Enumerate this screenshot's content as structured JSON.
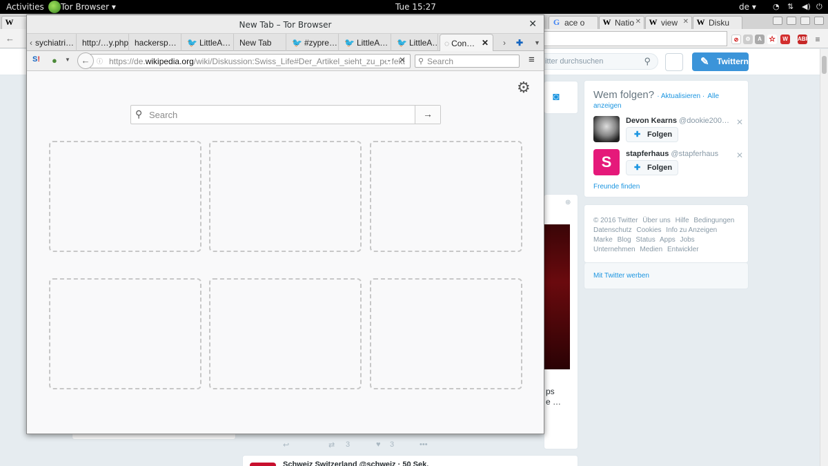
{
  "topbar": {
    "activities": "Activities",
    "app_name": "Tor Browser ▾",
    "clock": "Tue 15:27",
    "keyboard": "de ▾"
  },
  "background": {
    "tabs": [
      {
        "fav": "W",
        "label": "W",
        "color": "#000000"
      },
      {
        "fav": "G",
        "label": "ace o",
        "color": "#4285f4"
      },
      {
        "fav": "W",
        "label": "Natio",
        "color": "#000000"
      },
      {
        "fav": "W",
        "label": "view",
        "color": "#000000"
      },
      {
        "fav": "W",
        "label": "Disku",
        "color": "#000000"
      }
    ],
    "twitter": {
      "search_placeholder": "itter durchsuchen",
      "tweet_button": "Twittern",
      "who_to_follow": {
        "title": "Wem folgen?",
        "refresh": "· Aktualisieren ·",
        "all": "Alle",
        "all2": "anzeigen",
        "people": [
          {
            "name": "Devon Kearns",
            "handle": "@dookie200…",
            "button": "Folgen"
          },
          {
            "name": "stapferhaus",
            "handle": "@stapferhaus",
            "button": "Folgen"
          }
        ],
        "find_friends": "Freunde finden"
      },
      "footer": [
        "© 2016 Twitter",
        "Über uns",
        "Hilfe",
        "Bedingungen",
        "Datenschutz",
        "Cookies",
        "Info zu Anzeigen",
        "Marke",
        "Blog",
        "Status",
        "Apps",
        "Jobs",
        "Unternehmen",
        "Medien",
        "Entwickler"
      ],
      "advertise": "Mit Twitter werben",
      "tweet_action_retweets": "3",
      "tweet_action_likes": "3",
      "snippet1": "ps",
      "snippet2": "e …",
      "bottom_tweet": "Schweiz Switzerland @schweiz · 50 Sek."
    }
  },
  "tor": {
    "title": "New Tab – Tor Browser",
    "tabs": [
      {
        "label": "sychiatri…",
        "twitter": false
      },
      {
        "label": "http:/…y.php",
        "twitter": false
      },
      {
        "label": "hackersp…",
        "twitter": false
      },
      {
        "label": "LittleA…",
        "twitter": true
      },
      {
        "label": "New Tab",
        "twitter": false
      },
      {
        "label": "#zypre…",
        "twitter": true
      },
      {
        "label": "LittleA…",
        "twitter": true
      },
      {
        "label": "LittleA…",
        "twitter": true
      },
      {
        "label": "Con…",
        "twitter": false,
        "active": true
      }
    ],
    "url": {
      "prefix": "https://de.",
      "host": "wikipedia.org",
      "path": "/wiki/Diskussion:Swiss_Life#Der_Artikel_sieht_zu_perfekt"
    },
    "search_placeholder": "Search",
    "newtab_search_placeholder": "Search",
    "tile_count": 6
  }
}
